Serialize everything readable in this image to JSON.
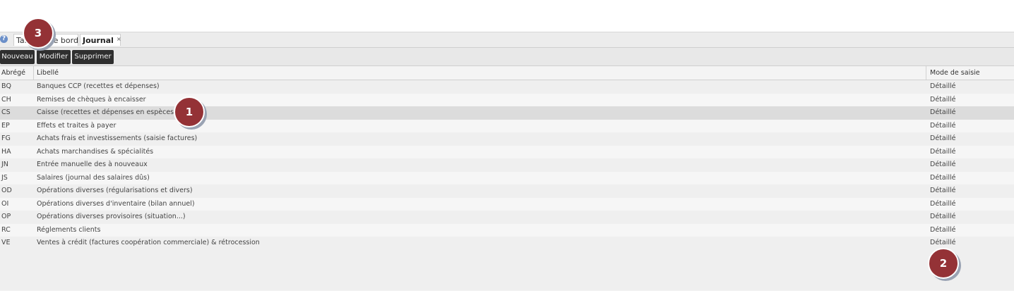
{
  "tabs": [
    {
      "label": "Tableau de bord",
      "close": "×"
    },
    {
      "label": "Journal",
      "close": "×"
    }
  ],
  "help_icon_glyph": "?",
  "toolbar": {
    "new_label": "Nouveau",
    "edit_label": "Modifier",
    "delete_label": "Supprimer"
  },
  "table": {
    "headers": {
      "code": "Abrégé",
      "label": "Libellé",
      "mode": "Mode de saisie"
    },
    "rows": [
      {
        "code": "BQ",
        "label": "Banques CCP (recettes et dépenses)",
        "mode": "Détaillé"
      },
      {
        "code": "CH",
        "label": "Remises de chèques à encaisser",
        "mode": "Détaillé"
      },
      {
        "code": "CS",
        "label": "Caisse (recettes et dépenses en espèces)",
        "mode": "Détaillé"
      },
      {
        "code": "EP",
        "label": "Effets et traites à payer",
        "mode": "Détaillé"
      },
      {
        "code": "FG",
        "label": "Achats frais et investissements (saisie factures)",
        "mode": "Détaillé"
      },
      {
        "code": "HA",
        "label": "Achats marchandises & spécialités",
        "mode": "Détaillé"
      },
      {
        "code": "JN",
        "label": "Entrée manuelle des à nouveaux",
        "mode": "Détaillé"
      },
      {
        "code": "JS",
        "label": "Salaires (journal des salaires dûs)",
        "mode": "Détaillé"
      },
      {
        "code": "OD",
        "label": "Opérations diverses (régularisations et divers)",
        "mode": "Détaillé"
      },
      {
        "code": "OI",
        "label": "Opérations diverses d'inventaire (bilan annuel)",
        "mode": "Détaillé"
      },
      {
        "code": "OP",
        "label": "Opérations diverses provisoires (situation...)",
        "mode": "Détaillé"
      },
      {
        "code": "RC",
        "label": "Réglements clients",
        "mode": "Détaillé"
      },
      {
        "code": "VE",
        "label": "Ventes à crédit (factures coopération commerciale) & rétrocession",
        "mode": "Détaillé"
      }
    ]
  },
  "callouts": [
    "1",
    "2",
    "3"
  ],
  "colors": {
    "callout": "#943236",
    "button": "#2f2f2f"
  }
}
